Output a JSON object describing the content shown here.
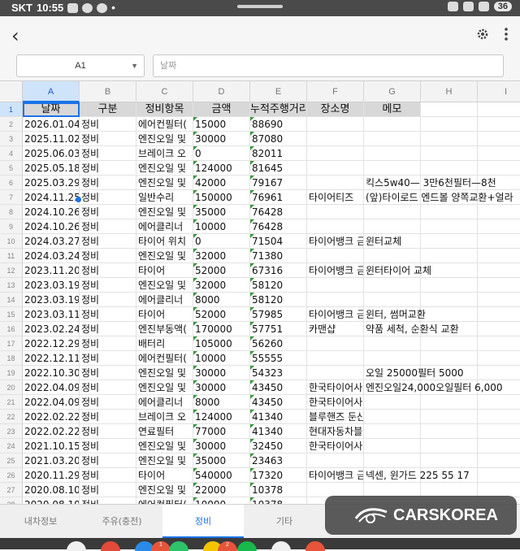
{
  "status_bar": {
    "carrier": "SKT",
    "time": "10:55",
    "battery": "36"
  },
  "formula_bar": {
    "cell_ref": "A1",
    "placeholder": "날짜"
  },
  "columns": [
    "A",
    "B",
    "C",
    "D",
    "E",
    "F",
    "G",
    "H",
    "I"
  ],
  "headers": [
    "날짜",
    "구분",
    "정비항목",
    "금액",
    "누적주행거리",
    "장소명",
    "메모"
  ],
  "rows": [
    [
      "2026.01.04",
      "정비",
      "에어컨필터(",
      "15000",
      "88690",
      "",
      ""
    ],
    [
      "2025.11.02",
      "정비",
      "엔진오일 및",
      "30000",
      "87080",
      "",
      ""
    ],
    [
      "2025.06.03",
      "정비",
      "브레이크 오",
      "0",
      "82011",
      "",
      ""
    ],
    [
      "2025.05.18",
      "정비",
      "엔진오일 및",
      "124000",
      "81645",
      "",
      ""
    ],
    [
      "2025.03.29",
      "정비",
      "엔진오일 및",
      "42000",
      "79167",
      "",
      "킥스5w40— 3만6천필터—8천"
    ],
    [
      "2024.11.25",
      "정비",
      "일반수리",
      "150000",
      "76961",
      "타이어티즈",
      "(앞)타이로드 엔드볼 양쪽교환+얼라"
    ],
    [
      "2024.10.26",
      "정비",
      "엔진오일 및",
      "35000",
      "76428",
      "",
      ""
    ],
    [
      "2024.10.26",
      "정비",
      "에어클리너",
      "10000",
      "76428",
      "",
      ""
    ],
    [
      "2024.03.27",
      "정비",
      "타이어 위치",
      "0",
      "71504",
      "타이어뱅크 금",
      "윈터교체"
    ],
    [
      "2024.03.24",
      "정비",
      "엔진오일 및",
      "32000",
      "71380",
      "",
      ""
    ],
    [
      "2023.11.20",
      "정비",
      "타이어",
      "52000",
      "67316",
      "타이어뱅크 금",
      "윈터타이어 교체"
    ],
    [
      "2023.03.19",
      "정비",
      "엔진오일 및",
      "32000",
      "58120",
      "",
      ""
    ],
    [
      "2023.03.19",
      "정비",
      "에어클리너",
      "8000",
      "58120",
      "",
      ""
    ],
    [
      "2023.03.11",
      "정비",
      "타이어",
      "52000",
      "57985",
      "타이어뱅크 금",
      "윈터, 썸머교환"
    ],
    [
      "2023.02.24",
      "정비",
      "엔진부동액(",
      "170000",
      "57751",
      "카맨샵",
      "약품 세척, 순환식 교환"
    ],
    [
      "2022.12.29",
      "정비",
      "배터리",
      "105000",
      "56260",
      "",
      ""
    ],
    [
      "2022.12.11",
      "정비",
      "에어컨필터(",
      "10000",
      "55555",
      "",
      ""
    ],
    [
      "2022.10.30",
      "정비",
      "엔진오일 및",
      "30000",
      "54323",
      "",
      "오일 25000필터 5000"
    ],
    [
      "2022.04.09",
      "정비",
      "엔진오일 및",
      "30000",
      "43450",
      "한국타이어사",
      "엔진오일24,000오일필터 6,000"
    ],
    [
      "2022.04.09",
      "정비",
      "에어클리너",
      "8000",
      "43450",
      "한국타이어사",
      ""
    ],
    [
      "2022.02.22",
      "정비",
      "브레이크 오",
      "124000",
      "41340",
      "블루핸즈 둔산",
      ""
    ],
    [
      "2022.02.22",
      "정비",
      "연료필터",
      "77000",
      "41340",
      "현대자동차블",
      ""
    ],
    [
      "2021.10.15",
      "정비",
      "엔진오일 및",
      "30000",
      "32450",
      "한국타이어사",
      ""
    ],
    [
      "2021.03.20",
      "정비",
      "엔진오일 및",
      "35000",
      "23463",
      "",
      ""
    ],
    [
      "2020.11.29",
      "정비",
      "타이어",
      "540000",
      "17320",
      "타이어뱅크 금",
      "넥센, 윈가드 225 55 17"
    ],
    [
      "2020.08.10",
      "정비",
      "엔진오일 및",
      "22000",
      "10378",
      "",
      ""
    ],
    [
      "2020.08.10",
      "정비",
      "에어컨필터(",
      "10000",
      "10378",
      "",
      ""
    ]
  ],
  "tabs": [
    {
      "label": "내차정보"
    },
    {
      "label": "주유(충전)"
    },
    {
      "label": "정비"
    },
    {
      "label": "기타"
    }
  ],
  "watermark": "CARSKOREA",
  "icons": [
    "back-arrow-icon",
    "settings-gear-icon",
    "more-vert-icon"
  ],
  "colors": {
    "accent": "#1a73e8",
    "header_fill": "#d8d8d8"
  }
}
